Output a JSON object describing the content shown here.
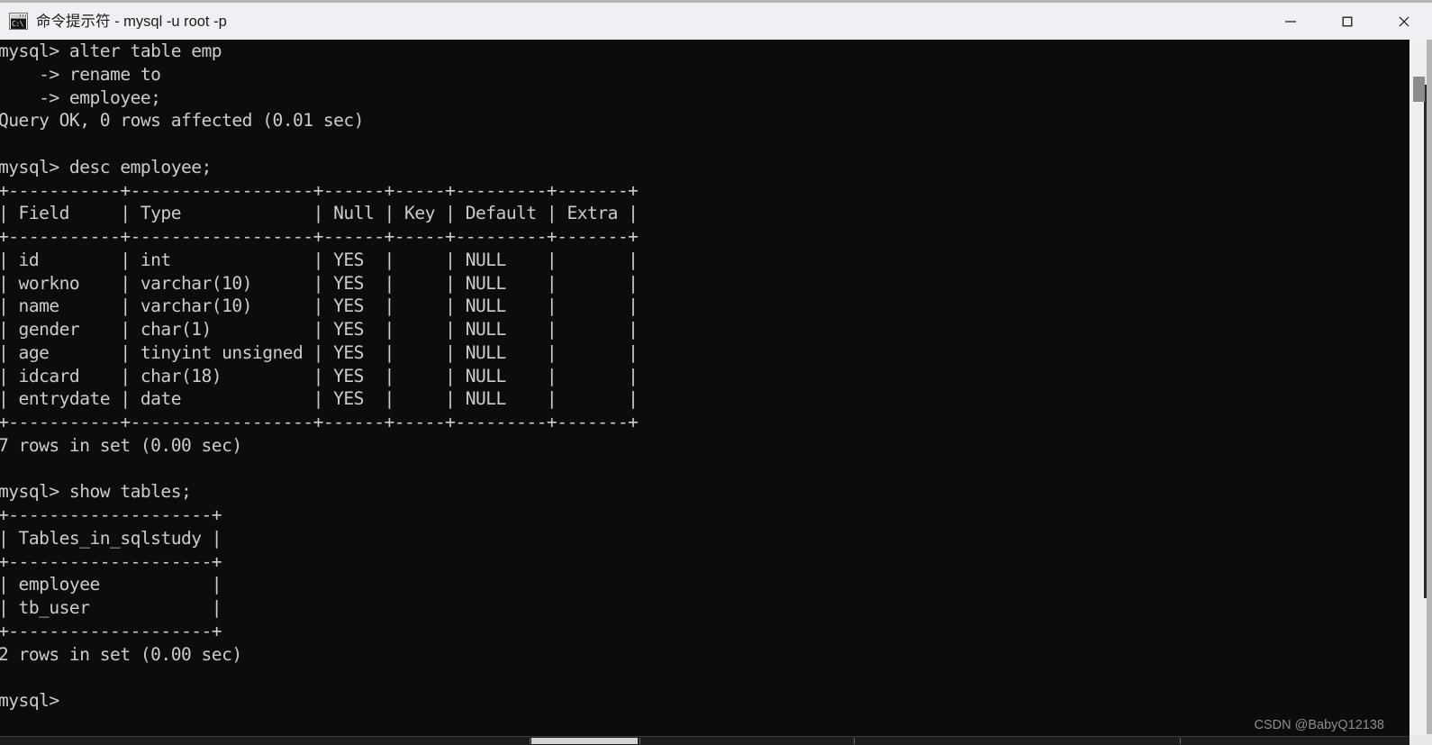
{
  "window": {
    "title": "命令提示符 - mysql  -u root -p",
    "icon_label": "C:\\",
    "icon_name": "cmd-icon",
    "colors": {
      "titlebar_bg": "#f0f0f4",
      "console_bg": "#0c0c0c",
      "console_fg": "#cccccc",
      "scrollbar_track": "#efeff0",
      "scrollbar_thumb": "#8c8c8c"
    },
    "controls": {
      "minimize": "minimize-icon",
      "maximize": "maximize-icon",
      "close": "close-icon"
    }
  },
  "console": {
    "prompt": "mysql>",
    "continuation_prompt": "->",
    "lines": [
      "mysql> alter table emp",
      "    -> rename to",
      "    -> employee;",
      "Query OK, 0 rows affected (0.01 sec)",
      "",
      "mysql> desc employee;",
      "+-----------+------------------+------+-----+---------+-------+",
      "| Field     | Type             | Null | Key | Default | Extra |",
      "+-----------+------------------+------+-----+---------+-------+",
      "| id        | int              | YES  |     | NULL    |       |",
      "| workno    | varchar(10)      | YES  |     | NULL    |       |",
      "| name      | varchar(10)      | YES  |     | NULL    |       |",
      "| gender    | char(1)          | YES  |     | NULL    |       |",
      "| age       | tinyint unsigned | YES  |     | NULL    |       |",
      "| idcard    | char(18)         | YES  |     | NULL    |       |",
      "| entrydate | date             | YES  |     | NULL    |       |",
      "+-----------+------------------+------+-----+---------+-------+",
      "7 rows in set (0.00 sec)",
      "",
      "mysql> show tables;",
      "+--------------------+",
      "| Tables_in_sqlstudy |",
      "+--------------------+",
      "| employee           |",
      "| tb_user            |",
      "+--------------------+",
      "2 rows in set (0.00 sec)",
      "",
      "mysql>"
    ],
    "commands": [
      "alter table emp rename to employee;",
      "desc employee;",
      "show tables;"
    ],
    "results": [
      {
        "statement": "alter table emp rename to employee;",
        "status": "Query OK, 0 rows affected (0.01 sec)"
      },
      {
        "statement": "desc employee;",
        "columns": [
          "Field",
          "Type",
          "Null",
          "Key",
          "Default",
          "Extra"
        ],
        "rows": [
          [
            "id",
            "int",
            "YES",
            "",
            "NULL",
            ""
          ],
          [
            "workno",
            "varchar(10)",
            "YES",
            "",
            "NULL",
            ""
          ],
          [
            "name",
            "varchar(10)",
            "YES",
            "",
            "NULL",
            ""
          ],
          [
            "gender",
            "char(1)",
            "YES",
            "",
            "NULL",
            ""
          ],
          [
            "age",
            "tinyint unsigned",
            "YES",
            "",
            "NULL",
            ""
          ],
          [
            "idcard",
            "char(18)",
            "YES",
            "",
            "NULL",
            ""
          ],
          [
            "entrydate",
            "date",
            "YES",
            "",
            "NULL",
            ""
          ]
        ],
        "status": "7 rows in set (0.00 sec)"
      },
      {
        "statement": "show tables;",
        "columns": [
          "Tables_in_sqlstudy"
        ],
        "rows": [
          [
            "employee"
          ],
          [
            "tb_user"
          ]
        ],
        "status": "2 rows in set (0.00 sec)"
      }
    ]
  },
  "watermark": {
    "text": "CSDN @BabyQ12138"
  }
}
